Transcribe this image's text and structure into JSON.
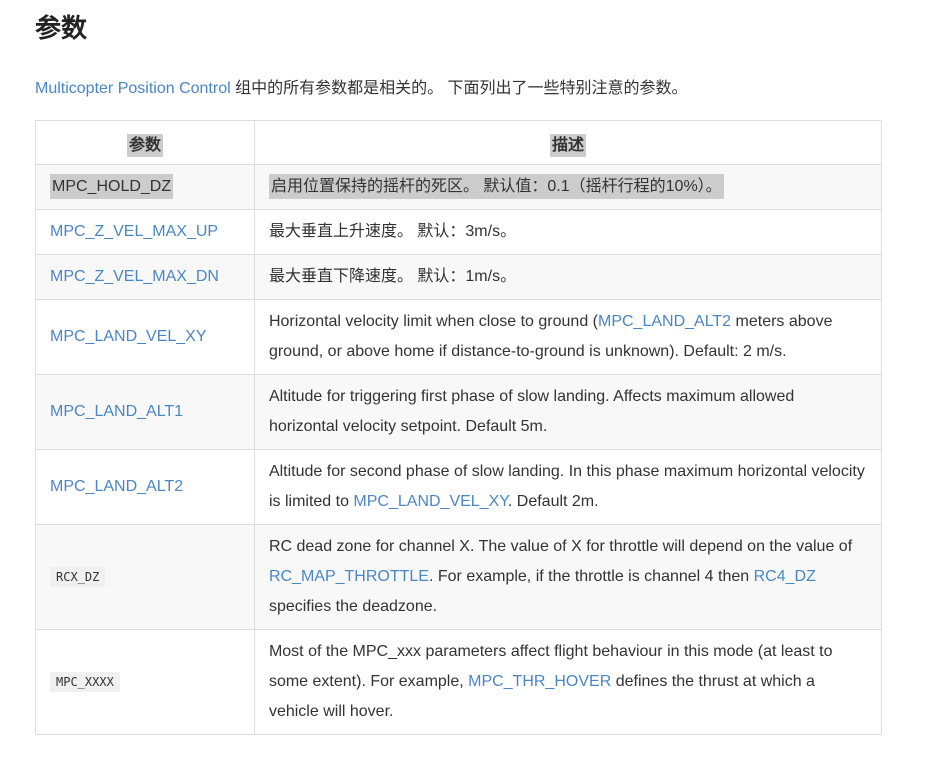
{
  "heading": "参数",
  "intro": {
    "link": "Multicopter Position Control",
    "text": " 组中的所有参数都是相关的。 下面列出了一些特别注意的参数。"
  },
  "table": {
    "headers": [
      "参数",
      "描述"
    ],
    "rows": [
      {
        "param": "MPC_HOLD_DZ",
        "desc": "启用位置保持的摇杆的死区。 默认值：0.1（摇杆行程的10%）。"
      },
      {
        "param": "MPC_Z_VEL_MAX_UP",
        "desc": "最大垂直上升速度。 默认：3m/s。"
      },
      {
        "param": "MPC_Z_VEL_MAX_DN",
        "desc": "最大垂直下降速度。 默认：1m/s。"
      },
      {
        "param": "MPC_LAND_VEL_XY",
        "desc_pre": "Horizontal velocity limit when close to ground (",
        "desc_link": "MPC_LAND_ALT2",
        "desc_post": " meters above ground, or above home if distance-to-ground is unknown). Default: 2 m/s."
      },
      {
        "param": "MPC_LAND_ALT1",
        "desc": "Altitude for triggering first phase of slow landing. Affects maximum allowed horizontal velocity setpoint. Default 5m."
      },
      {
        "param": "MPC_LAND_ALT2",
        "desc_pre": "Altitude for second phase of slow landing. In this phase maximum horizontal velocity is limited to ",
        "desc_link": "MPC_LAND_VEL_XY",
        "desc_post": ". Default 2m."
      },
      {
        "param": "RCX_DZ",
        "desc_pre": "RC dead zone for channel X. The value of X for throttle will depend on the value of ",
        "desc_link": "RC_MAP_THROTTLE",
        "desc_mid": ". For example, if the throttle is channel 4 then ",
        "desc_link2": "RC4_DZ",
        "desc_post": " specifies the deadzone."
      },
      {
        "param": "MPC_XXXX",
        "desc_pre": "Most of the MPC_xxx parameters affect flight behaviour in this mode (at least to some extent). For example, ",
        "desc_link": "MPC_THR_HOVER",
        "desc_post": " defines the thrust at which a vehicle will hover."
      }
    ]
  }
}
